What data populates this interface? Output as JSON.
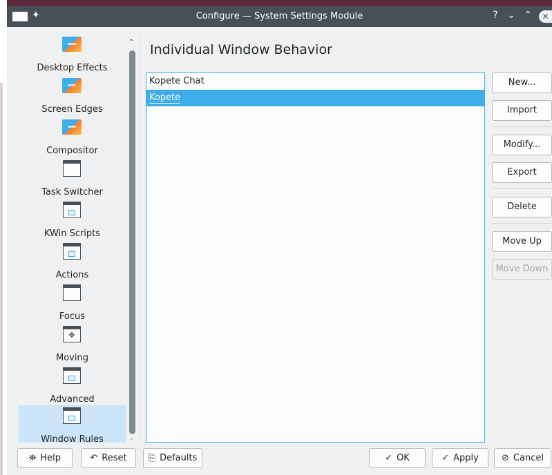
{
  "titlebar": {
    "title": "Configure — System Settings Module",
    "pin_icon": "pin-icon",
    "help_glyph": "?",
    "minimize_glyph": "⌄",
    "maximize_glyph": "⌃",
    "close_glyph": "✕"
  },
  "sidebar": {
    "items": [
      {
        "label": "Desktop Effects",
        "icon": "desktop-effects-icon"
      },
      {
        "label": "Screen Edges",
        "icon": "screen-edges-icon"
      },
      {
        "label": "Compositor",
        "icon": "compositor-icon"
      },
      {
        "label": "Task Switcher",
        "icon": "task-switcher-icon"
      },
      {
        "label": "KWin Scripts",
        "icon": "kwin-scripts-icon"
      },
      {
        "label": "Actions",
        "icon": "actions-icon"
      },
      {
        "label": "Focus",
        "icon": "focus-icon"
      },
      {
        "label": "Moving",
        "icon": "moving-icon"
      },
      {
        "label": "Advanced",
        "icon": "advanced-icon"
      },
      {
        "label": "Window Rules",
        "icon": "window-rules-icon",
        "selected": true
      }
    ],
    "scroll_up": "⌃",
    "scroll_down": "⌄"
  },
  "main": {
    "title": "Individual Window Behavior",
    "rules": [
      {
        "label": "Kopete Chat",
        "selected": false
      },
      {
        "label": "Kopete",
        "selected": true
      }
    ]
  },
  "actions": {
    "new": "New...",
    "import": "Import",
    "modify": "Modify...",
    "export": "Export",
    "delete": "Delete",
    "move_up": "Move Up",
    "move_down": "Move Down"
  },
  "footer": {
    "help": "Help",
    "reset": "Reset",
    "defaults": "Defaults",
    "ok": "OK",
    "apply": "Apply",
    "cancel": "Cancel"
  },
  "colors": {
    "accent": "#3daee9",
    "titlebar": "#475057",
    "window_bg": "#eff0f1",
    "selection_bg": "#cbe4f7"
  }
}
